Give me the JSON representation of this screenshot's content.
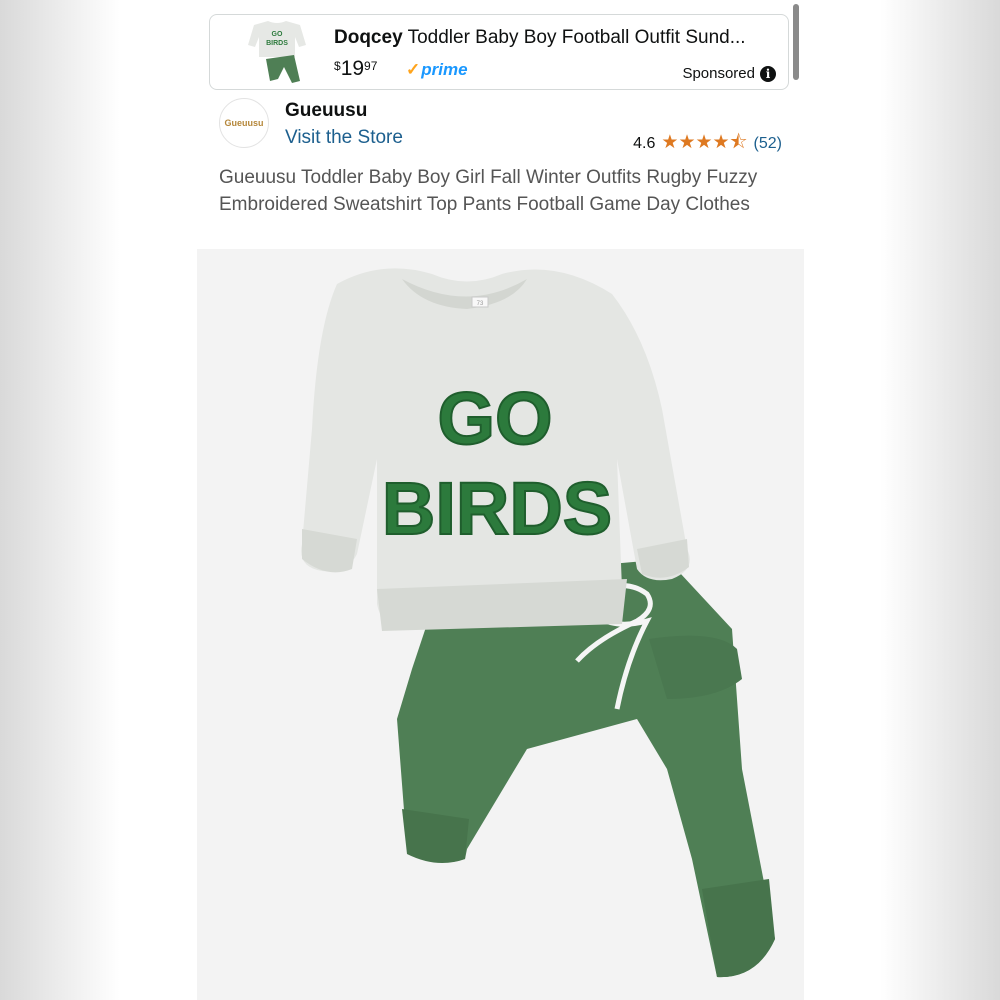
{
  "ad": {
    "brand": "Doqcey",
    "title": " Toddler Baby Boy Football Outfit Sund...",
    "price_symbol": "$",
    "price_whole": "19",
    "price_fraction": "97",
    "prime_label": "prime",
    "sponsored_label": "Sponsored",
    "thumb_text_top": "GO",
    "thumb_text_bottom": "BIRDS"
  },
  "store": {
    "logo_text": "Gueuusu",
    "name": "Gueuusu",
    "visit_label": "Visit the Store",
    "rating_value": "4.6",
    "rating_stars": 4.6,
    "review_count": "(52)"
  },
  "product": {
    "title": "Gueuusu Toddler Baby Boy Girl Fall Winter Outfits Rugby Fuzzy Embroidered Sweatshirt Top Pants Football Game Day Clothes",
    "image_text_line1": "GO",
    "image_text_line2": "BIRDS",
    "size_tag": "73"
  },
  "colors": {
    "star": "#de7921",
    "link": "#1c5f8e",
    "prime": "#1a98ff",
    "shirt": "#e4e6e3",
    "pants": "#4f7f55",
    "lettering": "#2c7a3c"
  }
}
